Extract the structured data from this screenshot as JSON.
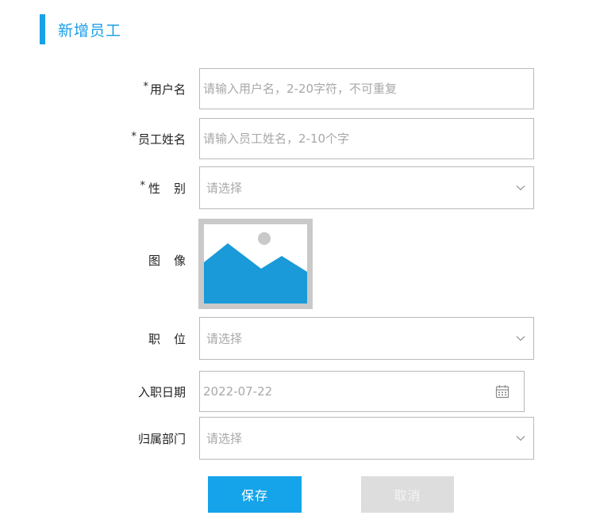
{
  "header": {
    "title": "新增员工"
  },
  "form": {
    "username": {
      "required_mark": "*",
      "label": "用户名",
      "placeholder": "请输入用户名，2-20字符，不可重复"
    },
    "name": {
      "required_mark": "*",
      "label": "员工姓名",
      "placeholder": "请输入员工姓名，2-10个字"
    },
    "gender": {
      "required_mark": "*",
      "label": "性别",
      "selected": "请选择"
    },
    "avatar": {
      "label": "图像"
    },
    "position": {
      "label": "职位",
      "selected": "请选择"
    },
    "hire_date": {
      "label": "入职日期",
      "value": "2022-07-22"
    },
    "department": {
      "label": "归属部门",
      "selected": "请选择"
    }
  },
  "actions": {
    "save_label": "保存",
    "cancel_label": "取消"
  },
  "colors": {
    "accent": "#1aa1e6",
    "save_button": "#15a3ea",
    "cancel_button": "#dddddd",
    "image_placeholder": "#1a9ad8"
  }
}
